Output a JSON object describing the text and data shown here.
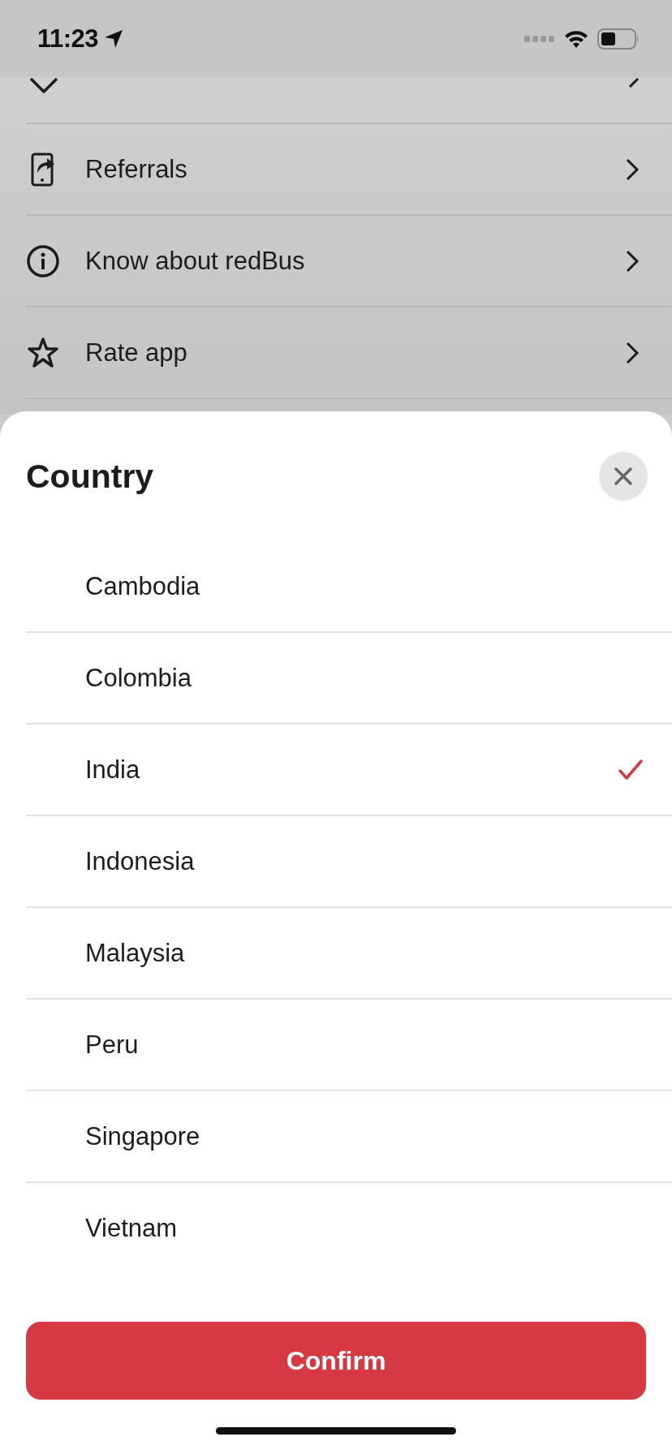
{
  "status_bar": {
    "time": "11:23"
  },
  "menu": {
    "items": [
      {
        "label": "Referrals"
      },
      {
        "label": "Know about redBus"
      },
      {
        "label": "Rate app"
      }
    ]
  },
  "sheet": {
    "title": "Country",
    "countries": [
      {
        "label": "Cambodia",
        "selected": false
      },
      {
        "label": "Colombia",
        "selected": false
      },
      {
        "label": "India",
        "selected": true
      },
      {
        "label": "Indonesia",
        "selected": false
      },
      {
        "label": "Malaysia",
        "selected": false
      },
      {
        "label": "Peru",
        "selected": false
      },
      {
        "label": "Singapore",
        "selected": false
      },
      {
        "label": "Vietnam",
        "selected": false
      }
    ],
    "confirm_button": "Confirm"
  }
}
